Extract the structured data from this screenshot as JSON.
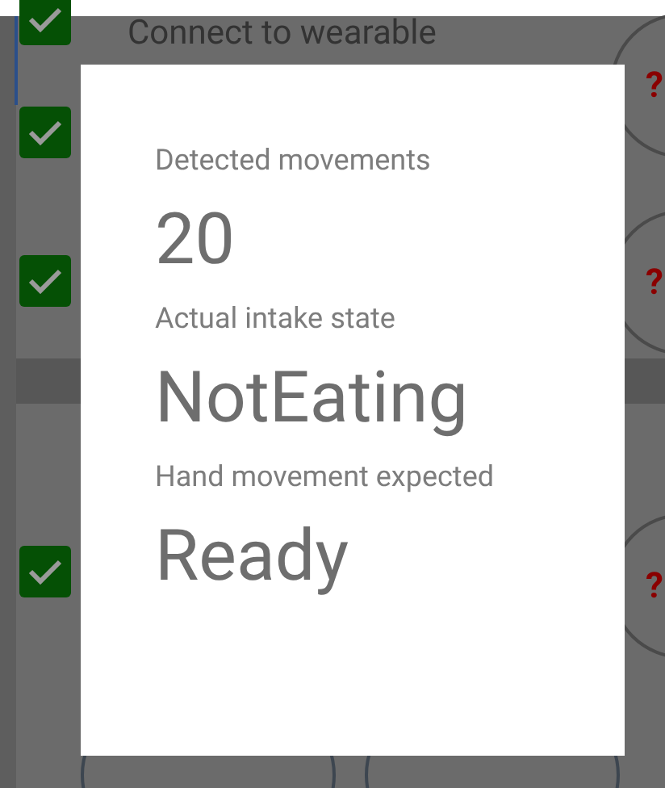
{
  "background": {
    "steps": [
      {
        "label": "Connect to wearable",
        "checked": true
      },
      {
        "checked": true
      },
      {
        "checked": true
      },
      {
        "checked": true
      }
    ],
    "help_buttons": [
      "?",
      "?",
      "?"
    ]
  },
  "dialog": {
    "fields": [
      {
        "label": "Detected movements",
        "value": "20"
      },
      {
        "label": "Actual intake state",
        "value": "NotEating"
      },
      {
        "label": "Hand movement expected",
        "value": "Ready"
      }
    ]
  }
}
